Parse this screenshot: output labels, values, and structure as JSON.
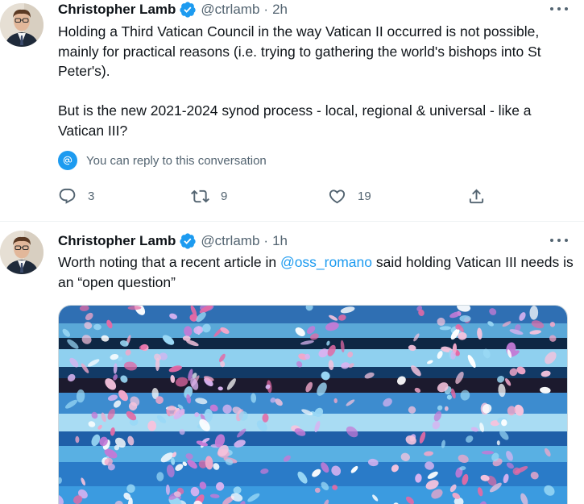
{
  "tweets": [
    {
      "author_name": "Christopher Lamb",
      "handle": "@ctrlamb",
      "separator": "·",
      "time": "2h",
      "paragraphs": [
        "Holding a Third Vatican Council in the way Vatican II occurred is not possible, mainly for practical reasons (i.e. trying to gathering the world's bishops into St Peter's).",
        "But is the new 2021-2024 synod process - local, regional & universal - like a Vatican III?"
      ],
      "reply_restriction": "You can reply to this conversation",
      "reply_count": "3",
      "retweet_count": "9",
      "like_count": "19"
    },
    {
      "author_name": "Christopher Lamb",
      "handle": "@ctrlamb",
      "separator": "·",
      "time": "1h",
      "text_before": "Worth noting that a recent article in ",
      "mention": "@oss_romano",
      "text_after": " said holding Vatican III needs is an “open question”"
    }
  ],
  "colors": {
    "accent": "#1d9bf0",
    "secondary_text": "#536471",
    "primary_text": "#0f1419",
    "divider": "#eff3f4"
  },
  "icons": [
    "verified-badge-icon",
    "more-options-icon",
    "reply-icon",
    "retweet-icon",
    "like-icon",
    "share-icon",
    "mention-reply-icon"
  ]
}
